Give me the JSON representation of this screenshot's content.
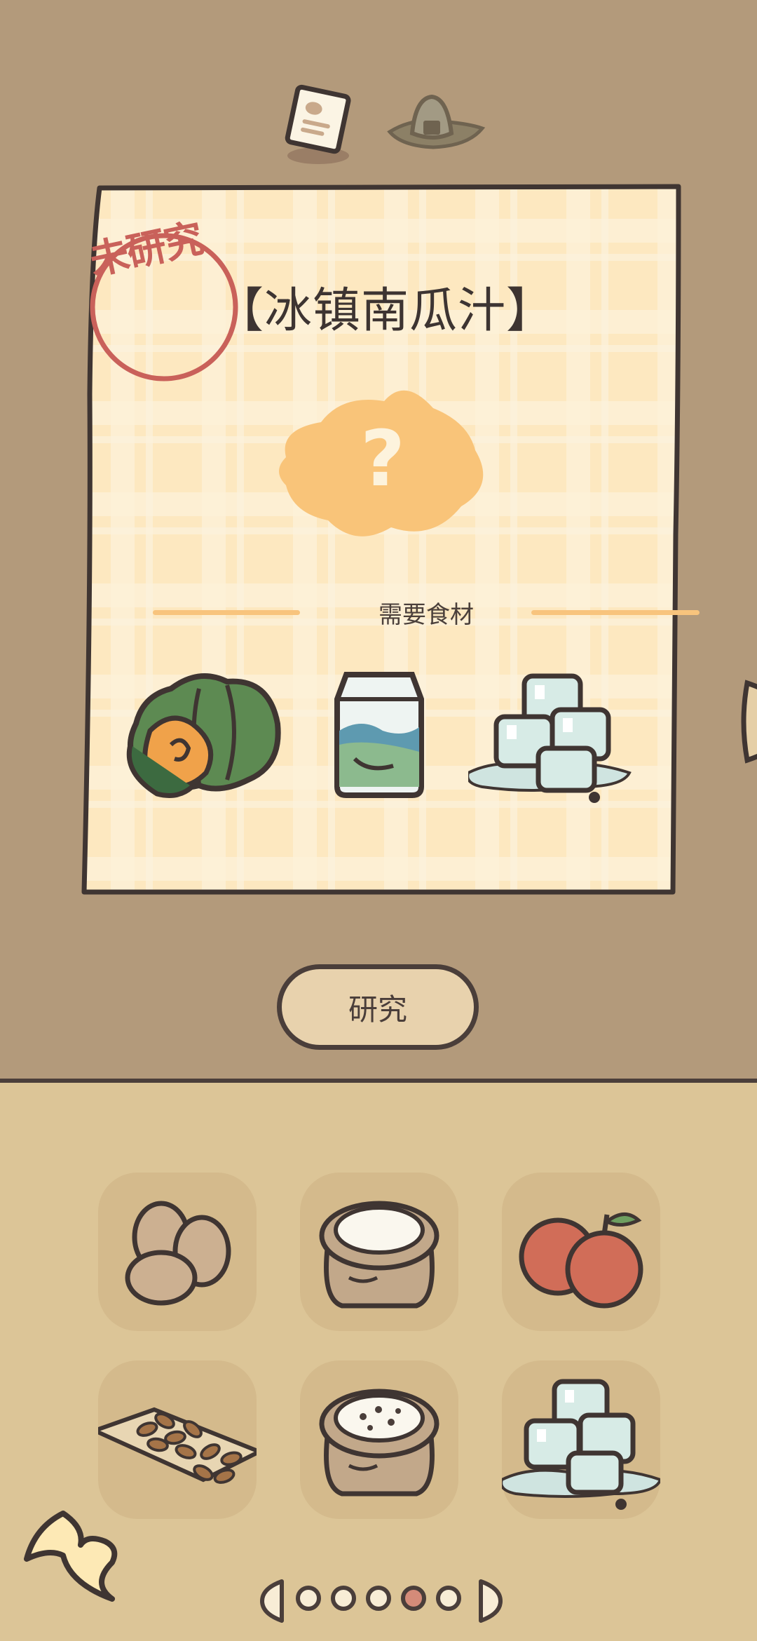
{
  "recipe": {
    "status_stamp": "未研究",
    "title": "【冰镇南瓜汁】",
    "ingredients_header": "需要食材",
    "ingredients": [
      "pumpkin-icon",
      "milk-carton-icon",
      "ice-cubes-icon"
    ]
  },
  "actions": {
    "research_label": "研究"
  },
  "inventory": {
    "items": [
      "eggs-icon",
      "flour-sack-icon",
      "apples-icon",
      "almonds-icon",
      "sugar-sack-icon",
      "ice-cubes-icon"
    ]
  },
  "pager": {
    "total": 5,
    "current": 4
  },
  "colors": {
    "top_background": "#b39a7b",
    "bottom_background": "#dcc597",
    "card_paper": "#fdebc4",
    "stamp_red": "#c9615a",
    "mystery_orange": "#f9c479",
    "outline": "#4a3e3a"
  }
}
